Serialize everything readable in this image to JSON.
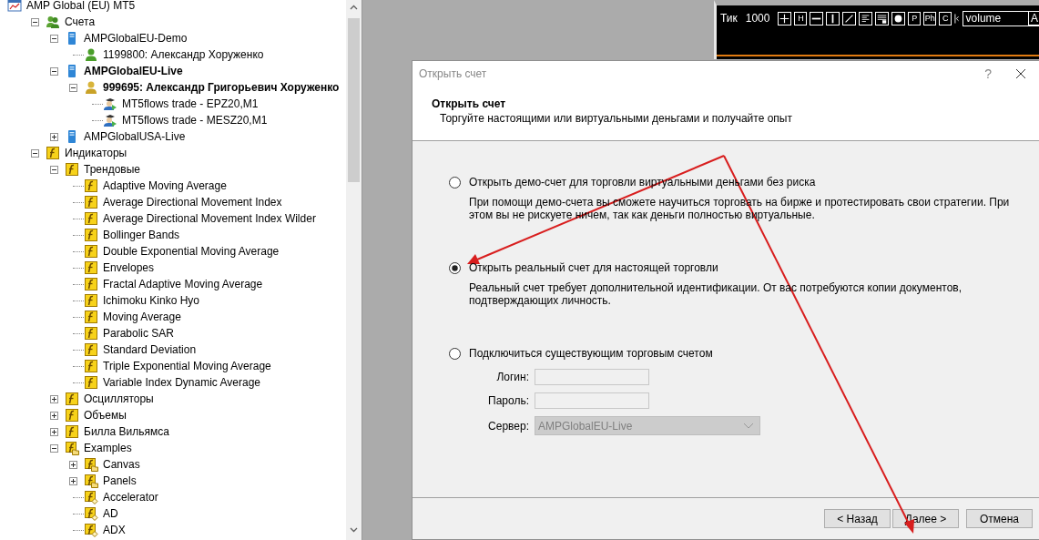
{
  "navigator": {
    "tree": [
      {
        "label": "AMP Global (EU) MT5",
        "kind": "terminal",
        "bold": false,
        "children": [
          {
            "label": "Счета",
            "kind": "accounts",
            "bold": false,
            "expanded": true,
            "children": [
              {
                "label": "AMPGlobalEU-Demo",
                "kind": "server",
                "bold": false,
                "expanded": true,
                "children": [
                  {
                    "label": "1199800: Александр Хоруженко",
                    "kind": "user",
                    "bold": false
                  }
                ]
              },
              {
                "label": "AMPGlobalEU-Live",
                "kind": "server",
                "bold": true,
                "expanded": true,
                "children": [
                  {
                    "label": "999695: Александр Григорьевич Хоруженко",
                    "kind": "gold-user",
                    "bold": true,
                    "expanded": true,
                    "children": [
                      {
                        "label": "MT5flows trade - EPZ20,M1",
                        "kind": "expert",
                        "bold": false
                      },
                      {
                        "label": "MT5flows trade - MESZ20,M1",
                        "kind": "expert",
                        "bold": false
                      }
                    ]
                  }
                ]
              },
              {
                "label": "AMPGlobalUSA-Live",
                "kind": "server",
                "bold": false,
                "expanded": false
              }
            ]
          },
          {
            "label": "Индикаторы",
            "kind": "function",
            "bold": false,
            "expanded": true,
            "children": [
              {
                "label": "Трендовые",
                "kind": "function",
                "bold": false,
                "expanded": true,
                "children": [
                  {
                    "label": "Adaptive Moving Average",
                    "kind": "function",
                    "bold": false
                  },
                  {
                    "label": "Average Directional Movement Index",
                    "kind": "function",
                    "bold": false
                  },
                  {
                    "label": "Average Directional Movement Index Wilder",
                    "kind": "function",
                    "bold": false
                  },
                  {
                    "label": "Bollinger Bands",
                    "kind": "function",
                    "bold": false
                  },
                  {
                    "label": "Double Exponential Moving Average",
                    "kind": "function",
                    "bold": false
                  },
                  {
                    "label": "Envelopes",
                    "kind": "function",
                    "bold": false
                  },
                  {
                    "label": "Fractal Adaptive Moving Average",
                    "kind": "function",
                    "bold": false
                  },
                  {
                    "label": "Ichimoku Kinko Hyo",
                    "kind": "function",
                    "bold": false
                  },
                  {
                    "label": "Moving Average",
                    "kind": "function",
                    "bold": false
                  },
                  {
                    "label": "Parabolic SAR",
                    "kind": "function",
                    "bold": false
                  },
                  {
                    "label": "Standard Deviation",
                    "kind": "function",
                    "bold": false
                  },
                  {
                    "label": "Triple Exponential Moving Average",
                    "kind": "function",
                    "bold": false
                  },
                  {
                    "label": "Variable Index Dynamic Average",
                    "kind": "function",
                    "bold": false
                  }
                ]
              },
              {
                "label": "Осцилляторы",
                "kind": "function",
                "bold": false,
                "expanded": false
              },
              {
                "label": "Объемы",
                "kind": "function",
                "bold": false,
                "expanded": false
              },
              {
                "label": "Билла Вильямса",
                "kind": "function",
                "bold": false,
                "expanded": false
              },
              {
                "label": "Examples",
                "kind": "function-folder",
                "bold": false,
                "expanded": true,
                "children": [
                  {
                    "label": "Canvas",
                    "kind": "function-folder",
                    "bold": false,
                    "expanded": false
                  },
                  {
                    "label": "Panels",
                    "kind": "function-folder",
                    "bold": false,
                    "expanded": false
                  },
                  {
                    "label": "Accelerator",
                    "kind": "function-file",
                    "bold": false
                  },
                  {
                    "label": "AD",
                    "kind": "function-file",
                    "bold": false
                  },
                  {
                    "label": "ADX",
                    "kind": "function-file",
                    "bold": false
                  }
                ]
              }
            ]
          }
        ]
      }
    ]
  },
  "chart": {
    "timeframe": "Тик",
    "count": "1000",
    "tools": [
      {
        "kind": "crosshair"
      },
      {
        "kind": "text",
        "label": "H"
      },
      {
        "kind": "hline"
      },
      {
        "kind": "vline"
      },
      {
        "kind": "trend"
      },
      {
        "kind": "lines"
      },
      {
        "kind": "fibo"
      },
      {
        "kind": "dot"
      },
      {
        "kind": "text",
        "label": "P"
      },
      {
        "kind": "text",
        "label": "Ph"
      },
      {
        "kind": "text",
        "label": "C"
      }
    ],
    "indicator_field": {
      "value": "volume",
      "button": "A"
    }
  },
  "dialog": {
    "title": "Открыть счет",
    "help": "?",
    "header_title": "Открыть счет",
    "header_subtitle": "Торгуйте настоящими или виртуальными деньгами и получайте опыт",
    "options": [
      {
        "label": "Открыть демо-счет для торговли виртуальными деньгами без риска",
        "selected": false,
        "description": "При помощи демо-счета вы сможете научиться торговать на бирже и протестировать свои стратегии. При этом вы не рискуете ничем, так как деньги полностью виртуальные."
      },
      {
        "label": "Открыть реальный счет для настоящей торговли",
        "selected": true,
        "description": "Реальный счет требует дополнительной идентификации. От вас потребуются копии документов, подтверждающих личность."
      },
      {
        "label": "Подключиться существующим торговым счетом",
        "selected": false
      }
    ],
    "fields": [
      {
        "label": "Логин:",
        "kind": "text",
        "disabled": false
      },
      {
        "label": "Пароль:",
        "kind": "text",
        "disabled": false
      },
      {
        "label": "Сервер:",
        "kind": "select",
        "value": "AMPGlobalEU-Live",
        "disabled": true
      }
    ],
    "buttons": [
      {
        "label": "< Назад"
      },
      {
        "label": "Далее >"
      },
      {
        "label": "Отмена"
      }
    ]
  }
}
